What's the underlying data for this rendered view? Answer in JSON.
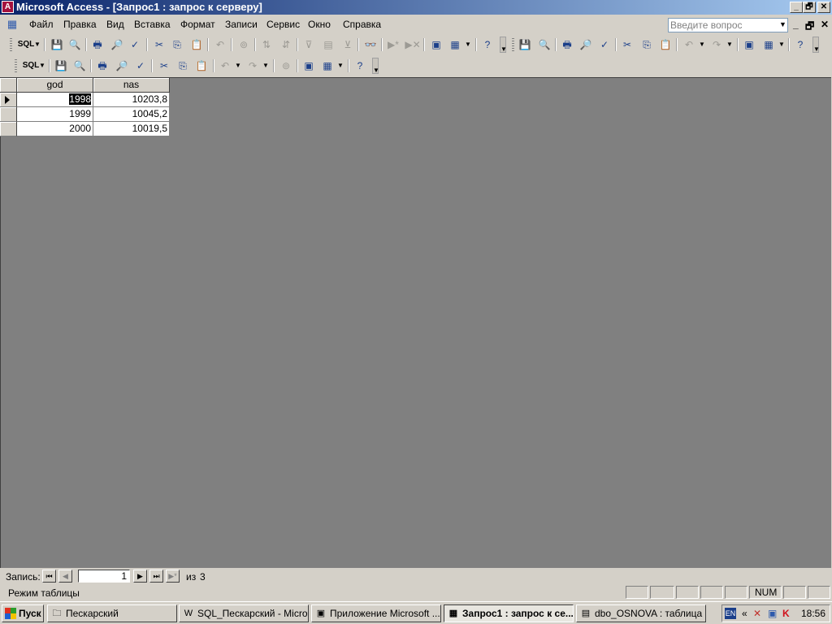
{
  "window": {
    "title": "Microsoft Access - [Запрос1 : запрос к серверу]",
    "icon": "access-app-icon",
    "controls": [
      "_",
      "🗗",
      "✕"
    ]
  },
  "menu": {
    "items": [
      "Файл",
      "Правка",
      "Вид",
      "Вставка",
      "Формат",
      "Записи",
      "Сервис",
      "Окно",
      "Справка"
    ],
    "ask_placeholder": "Введите вопрос",
    "mdi_controls": [
      "_",
      "🗗",
      "✕"
    ]
  },
  "toolbar": {
    "sql_label": "SQL"
  },
  "grid": {
    "columns": [
      "god",
      "nas"
    ],
    "rows": [
      {
        "god": "1998",
        "nas": "10203,8"
      },
      {
        "god": "1999",
        "nas": "10045,2"
      },
      {
        "god": "2000",
        "nas": "10019,5"
      }
    ]
  },
  "navigation": {
    "record_label": "Запись:",
    "current": "1",
    "of_label": "из",
    "total": "3"
  },
  "status": {
    "mode": "Режим таблицы",
    "num": "NUM"
  },
  "taskbar": {
    "start": "Пуск",
    "tasks": [
      {
        "label": "Пескарский",
        "icon": "folder-icon"
      },
      {
        "label": "SQL_Пескарский - Micro...",
        "icon": "word-icon"
      },
      {
        "label": "Приложение Microsoft ...",
        "icon": "window-icon"
      },
      {
        "label": "Запрос1 : запрос к се...",
        "icon": "query-icon"
      },
      {
        "label": "dbo_OSNOVA : таблица",
        "icon": "table-icon"
      }
    ],
    "lang": "EN",
    "clock": "18:56"
  }
}
